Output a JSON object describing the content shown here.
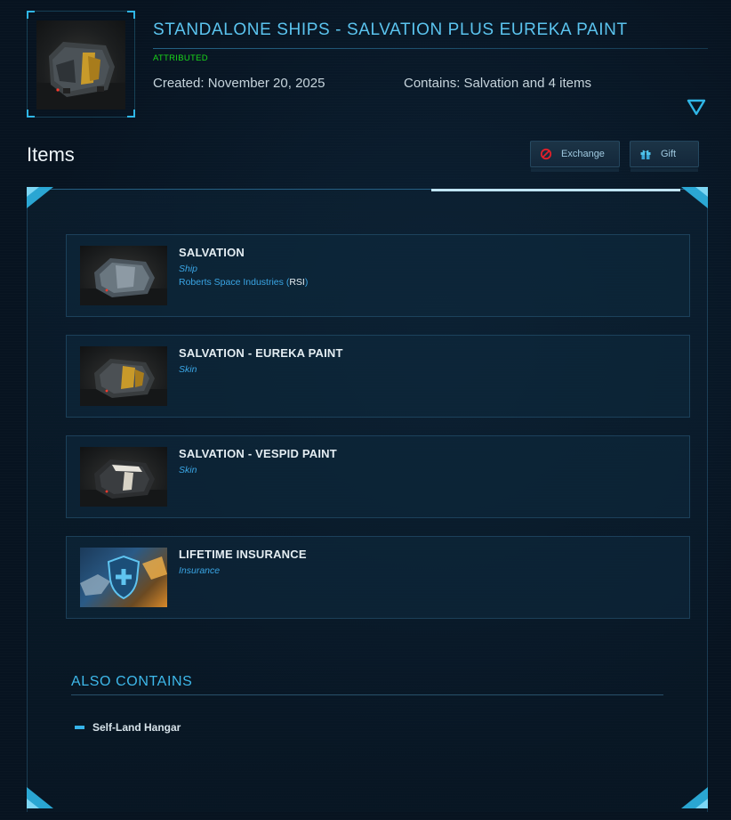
{
  "pledge": {
    "title": "STANDALONE SHIPS - SALVATION PLUS EUREKA PAINT",
    "status": "ATTRIBUTED",
    "created": "Created: November 20, 2025",
    "contains": "Contains: Salvation and 4 items",
    "thumbnail": "salvation-eureka-paint-ship-image"
  },
  "items_section": {
    "heading": "Items",
    "exchange_label": "Exchange",
    "gift_label": "Gift"
  },
  "items": [
    {
      "name": "SALVATION",
      "kind": "Ship",
      "manufacturer": "Roberts Space Industries",
      "manufacturer_code": "RSI",
      "thumbnail": "salvation-ship-image"
    },
    {
      "name": "SALVATION - EUREKA PAINT",
      "kind": "Skin",
      "thumbnail": "eureka-paint-image"
    },
    {
      "name": "SALVATION - VESPID PAINT",
      "kind": "Skin",
      "thumbnail": "vespid-paint-image"
    },
    {
      "name": "LIFETIME INSURANCE",
      "kind": "Insurance",
      "thumbnail": "insurance-shield-image"
    }
  ],
  "also_contains": {
    "heading": "ALSO CONTAINS",
    "items": [
      "Self-Land Hangar"
    ]
  },
  "colors": {
    "accent": "#3eb8ea",
    "title": "#5bc4ef",
    "attributed": "#19d619",
    "kind_text": "#3aa5e4",
    "background": "#071320",
    "exchange_icon": "#e0202a"
  },
  "icons": {
    "expand": "triangle-down-icon",
    "exchange": "no-entry-icon",
    "gift": "gift-icon",
    "bullet": "dash-bullet-icon"
  }
}
